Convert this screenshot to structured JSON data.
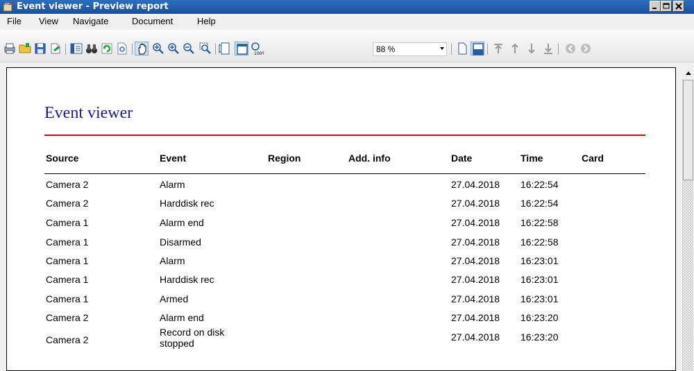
{
  "window": {
    "title": "Event viewer - Preview report"
  },
  "menu": [
    "File",
    "View",
    "Navigate",
    "Document",
    "Help"
  ],
  "toolbar": {
    "zoom_value": "88 %"
  },
  "report": {
    "title": "Event viewer",
    "columns": [
      "Source",
      "Event",
      "Region",
      "Add. info",
      "Date",
      "Time",
      "Card"
    ],
    "rows": [
      {
        "source": "Camera 2",
        "event": "Alarm",
        "date": "27.04.2018",
        "time": "16:22:54"
      },
      {
        "source": "Camera 2",
        "event": "Harddisk rec",
        "date": "27.04.2018",
        "time": "16:22:54"
      },
      {
        "source": "Camera 1",
        "event": "Alarm end",
        "date": "27.04.2018",
        "time": "16:22:58"
      },
      {
        "source": "Camera 1",
        "event": "Disarmed",
        "date": "27.04.2018",
        "time": "16:22:58"
      },
      {
        "source": "Camera 1",
        "event": "Alarm",
        "date": "27.04.2018",
        "time": "16:23:01"
      },
      {
        "source": "Camera 1",
        "event": "Harddisk rec",
        "date": "27.04.2018",
        "time": "16:23:01"
      },
      {
        "source": "Camera 1",
        "event": "Armed",
        "date": "27.04.2018",
        "time": "16:23:01"
      },
      {
        "source": "Camera 2",
        "event": "Alarm end",
        "date": "27.04.2018",
        "time": "16:23:20"
      },
      {
        "source": "Camera 2",
        "event": "Record on disk stopped",
        "event_line1": "Record on disk",
        "event_line2": "stopped",
        "date": "27.04.2018",
        "time": "16:23:20"
      }
    ]
  }
}
